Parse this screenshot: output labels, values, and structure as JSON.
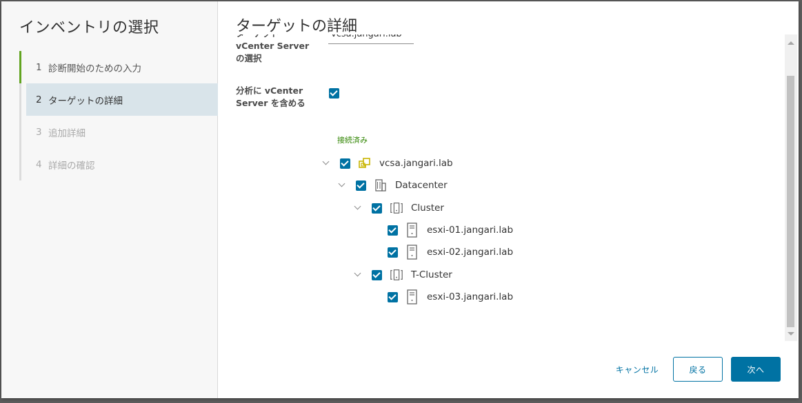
{
  "sidebar": {
    "title": "インベントリの選択",
    "steps": [
      {
        "num": "1",
        "label": "診断開始のための入力"
      },
      {
        "num": "2",
        "label": "ターゲットの詳細"
      },
      {
        "num": "3",
        "label": "追加詳細"
      },
      {
        "num": "4",
        "label": "詳細の確認"
      }
    ]
  },
  "main": {
    "title": "ターゲットの詳細",
    "vcenter_select_label_line1": "ターゲット",
    "vcenter_select_label_line2": "vCenter Server",
    "vcenter_select_label_line3": "の選択",
    "vcenter_select_value": "vcsa.jangari.lab",
    "include_vcenter_label_line1": "分析に vCenter",
    "include_vcenter_label_line2": "Server を含める",
    "include_vcenter_checked": true,
    "connected_label": "接続済み",
    "tree": [
      {
        "label": "vcsa.jangari.lab",
        "icon": "vcenter-icon",
        "checked": true
      },
      {
        "label": "Datacenter",
        "icon": "datacenter-icon",
        "checked": true
      },
      {
        "label": "Cluster",
        "icon": "cluster-icon",
        "checked": true
      },
      {
        "label": "esxi-01.jangari.lab",
        "icon": "host-icon",
        "checked": true
      },
      {
        "label": "esxi-02.jangari.lab",
        "icon": "host-icon",
        "checked": true
      },
      {
        "label": "T-Cluster",
        "icon": "cluster-icon",
        "checked": true
      },
      {
        "label": "esxi-03.jangari.lab",
        "icon": "host-icon",
        "checked": true
      }
    ]
  },
  "footer": {
    "cancel_label": "キャンセル",
    "back_label": "戻る",
    "next_label": "次へ"
  },
  "colors": {
    "primary": "#0072a3",
    "step_done": "#62a420",
    "connected": "#2f8400",
    "current_step_bg": "#d9e4ea"
  }
}
